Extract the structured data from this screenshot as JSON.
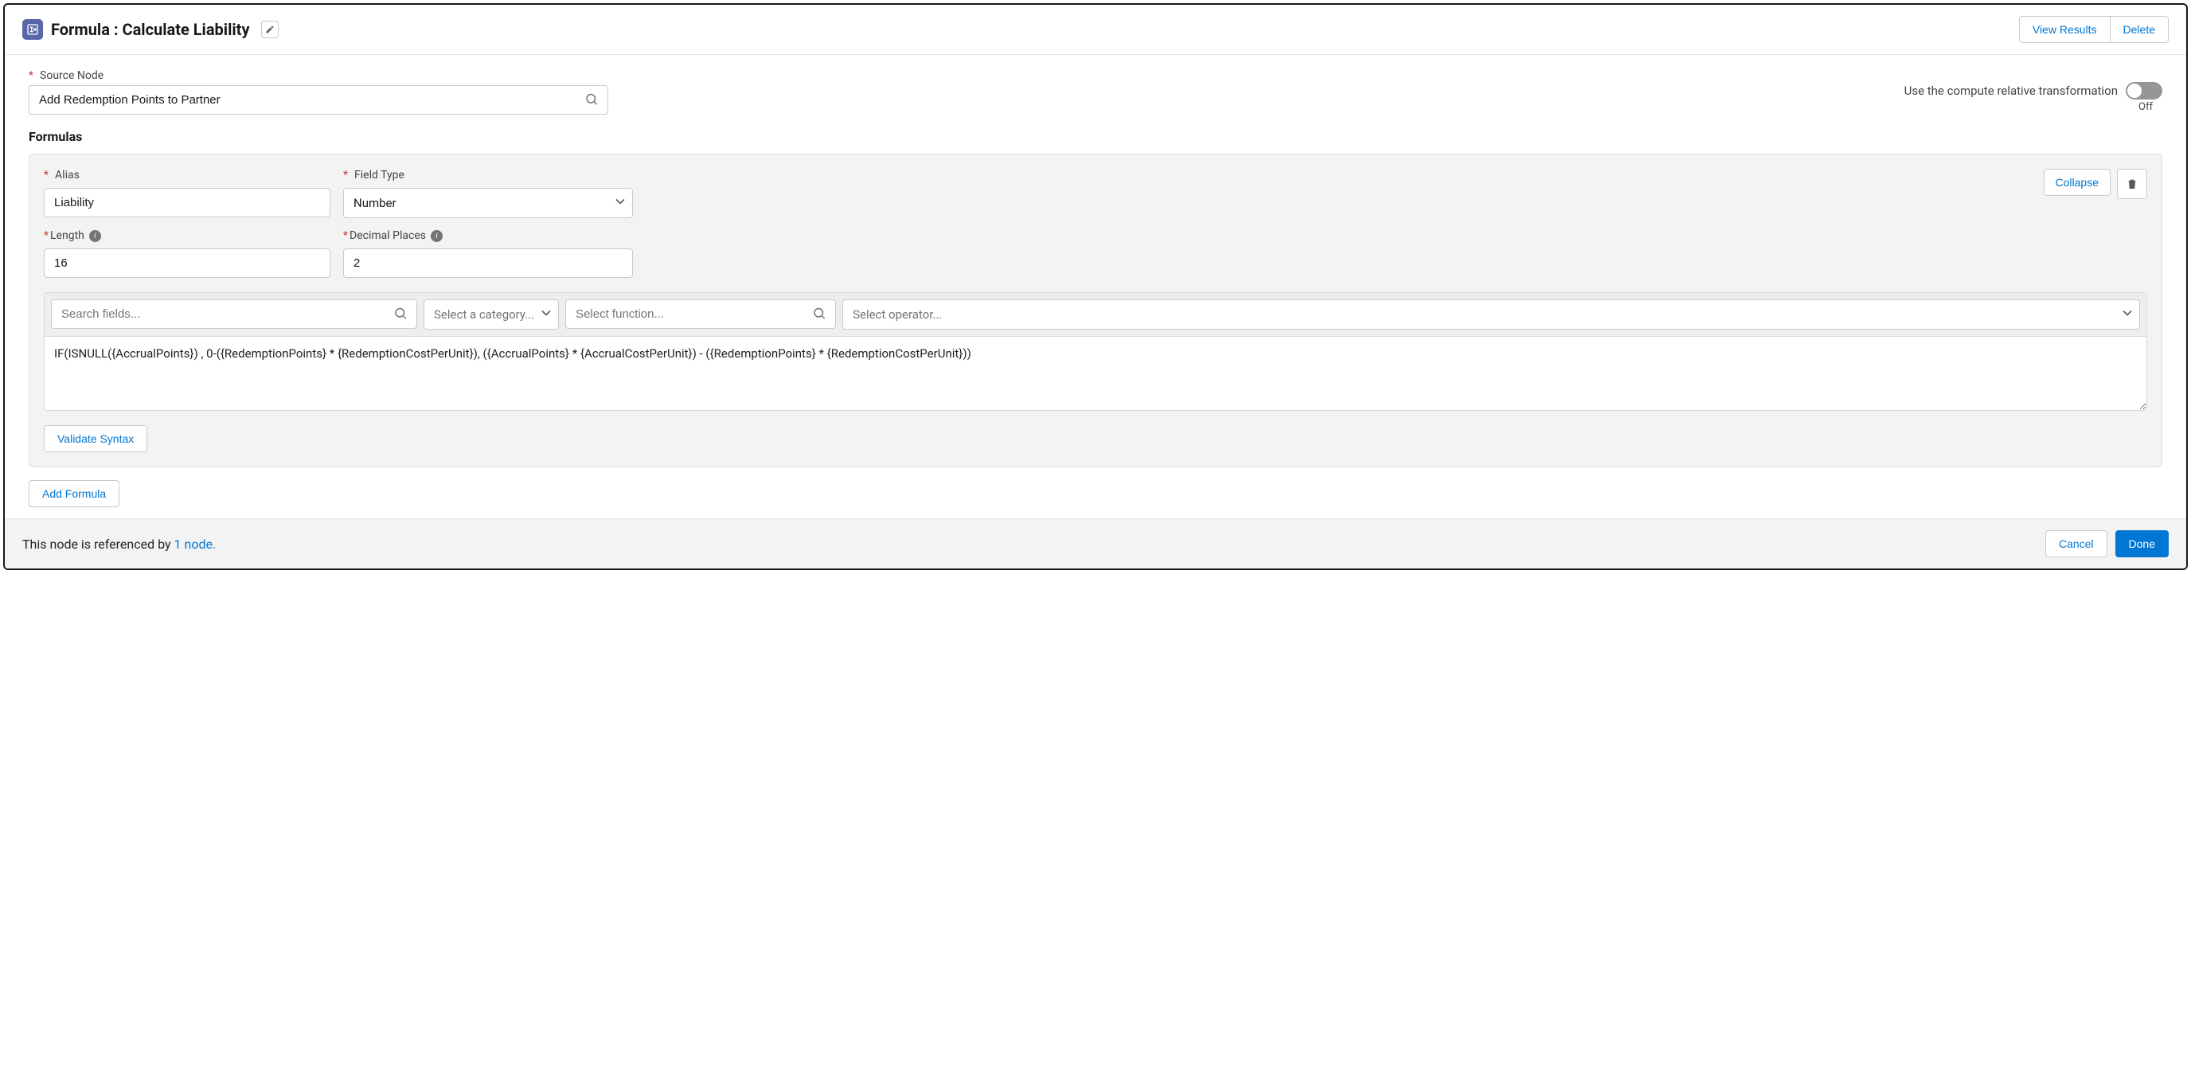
{
  "header": {
    "prefix": "Formula :",
    "title": "Calculate Liability",
    "view_results": "View Results",
    "delete": "Delete"
  },
  "source": {
    "label": "Source Node",
    "value": "Add Redemption Points to Partner"
  },
  "compute_toggle": {
    "label": "Use the compute relative transformation",
    "state_text": "Off",
    "value": false
  },
  "formulas_heading": "Formulas",
  "formula": {
    "alias_label": "Alias",
    "alias_value": "Liability",
    "field_type_label": "Field Type",
    "field_type_value": "Number",
    "length_label": "Length",
    "length_value": "16",
    "decimal_label": "Decimal Places",
    "decimal_value": "2",
    "collapse": "Collapse",
    "search_fields_placeholder": "Search fields...",
    "category_placeholder": "Select a category...",
    "function_placeholder": "Select function...",
    "operator_placeholder": "Select operator...",
    "expression": "IF(ISNULL({AccrualPoints}) , 0-({RedemptionPoints} * {RedemptionCostPerUnit}), ({AccrualPoints} * {AccrualCostPerUnit}) - ({RedemptionPoints} * {RedemptionCostPerUnit}))",
    "validate": "Validate Syntax"
  },
  "add_formula": "Add Formula",
  "footer": {
    "prefix": "This node is referenced by ",
    "link": "1 node.",
    "cancel": "Cancel",
    "done": "Done"
  }
}
